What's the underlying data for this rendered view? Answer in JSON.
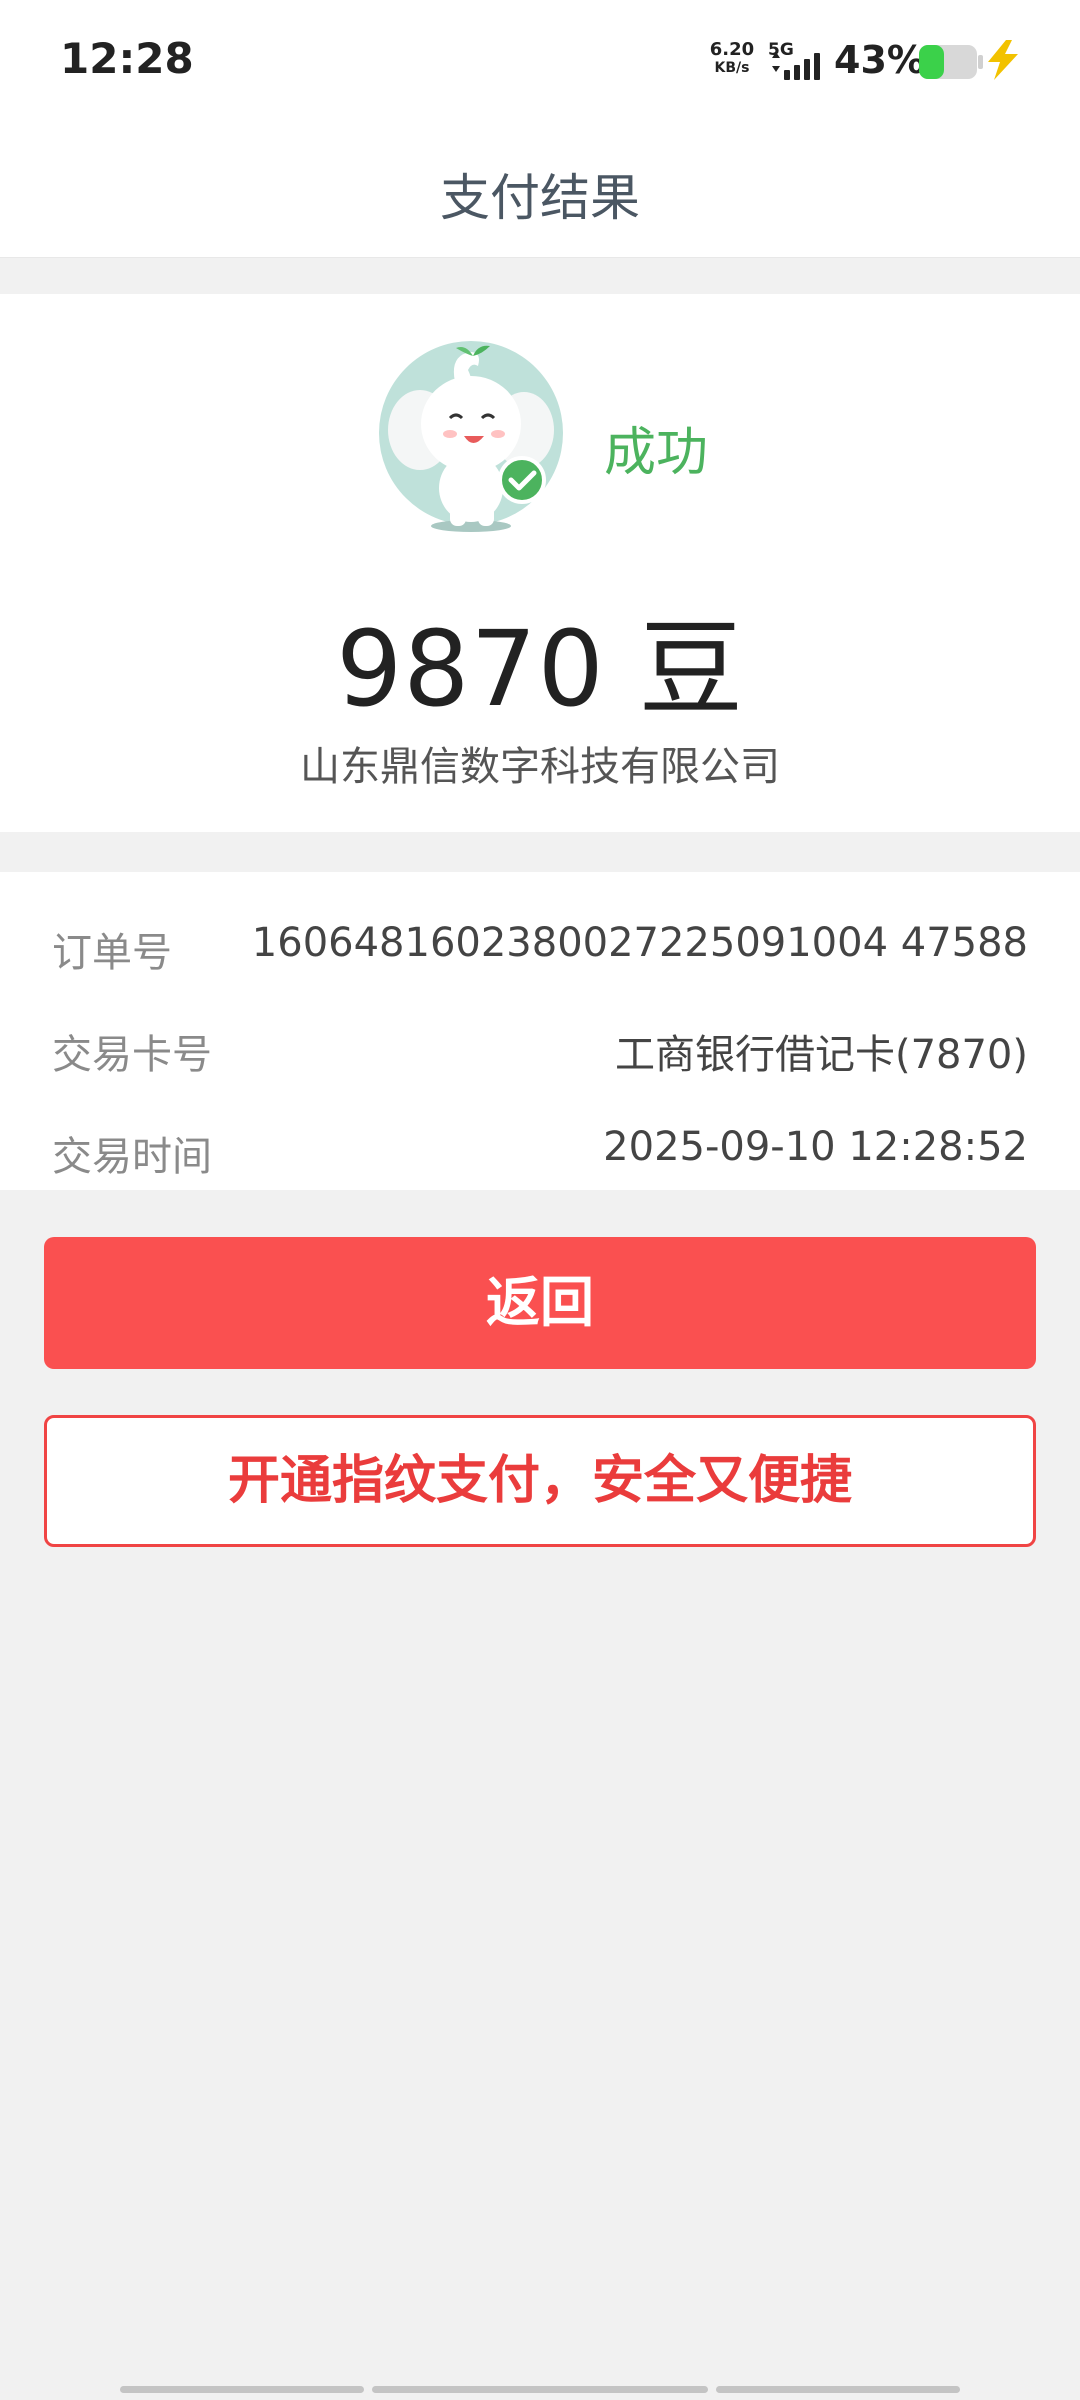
{
  "status_bar": {
    "time": "12:28",
    "net_speed_value": "6.20",
    "net_speed_unit": "KB/s",
    "network_type": "5G",
    "battery_percent": "43%",
    "battery_level": 0.43,
    "battery_color": "#3bd14a"
  },
  "header": {
    "title": "支付结果"
  },
  "result": {
    "status": "成功",
    "amount": "9870 豆",
    "merchant": "山东鼎信数字科技有限公司"
  },
  "details": {
    "rows": [
      {
        "label": "订单号",
        "value": "1606481602380027225091004 47588"
      },
      {
        "label": "交易卡号",
        "value": "工商银行借记卡(7870)"
      },
      {
        "label": "交易时间",
        "value": "2025-09-10 12:28:52"
      }
    ]
  },
  "actions": {
    "back_label": "返回",
    "fingerprint_label": "开通指纹支付，安全又便捷"
  },
  "colors": {
    "accent": "#fa5050",
    "success": "#4cb35e"
  }
}
